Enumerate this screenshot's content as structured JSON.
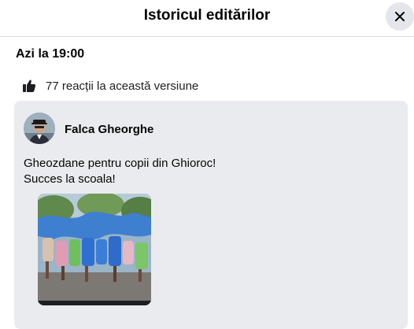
{
  "dialog": {
    "title": "Istoricul editărilor",
    "close_icon": "close-icon"
  },
  "edit": {
    "timestamp": "Azi la 19:00",
    "reactions_icon": "like-icon",
    "reactions_text": "77 reacții la această versiune"
  },
  "post": {
    "author": "Falca Gheorghe",
    "text_lines": [
      "Gheozdane pentru copii din Ghioroc!",
      "Succes la scoala!"
    ]
  },
  "colors": {
    "card_background": "#e9ebee",
    "close_button_background": "#e4e6eb",
    "divider": "#dadde1"
  }
}
